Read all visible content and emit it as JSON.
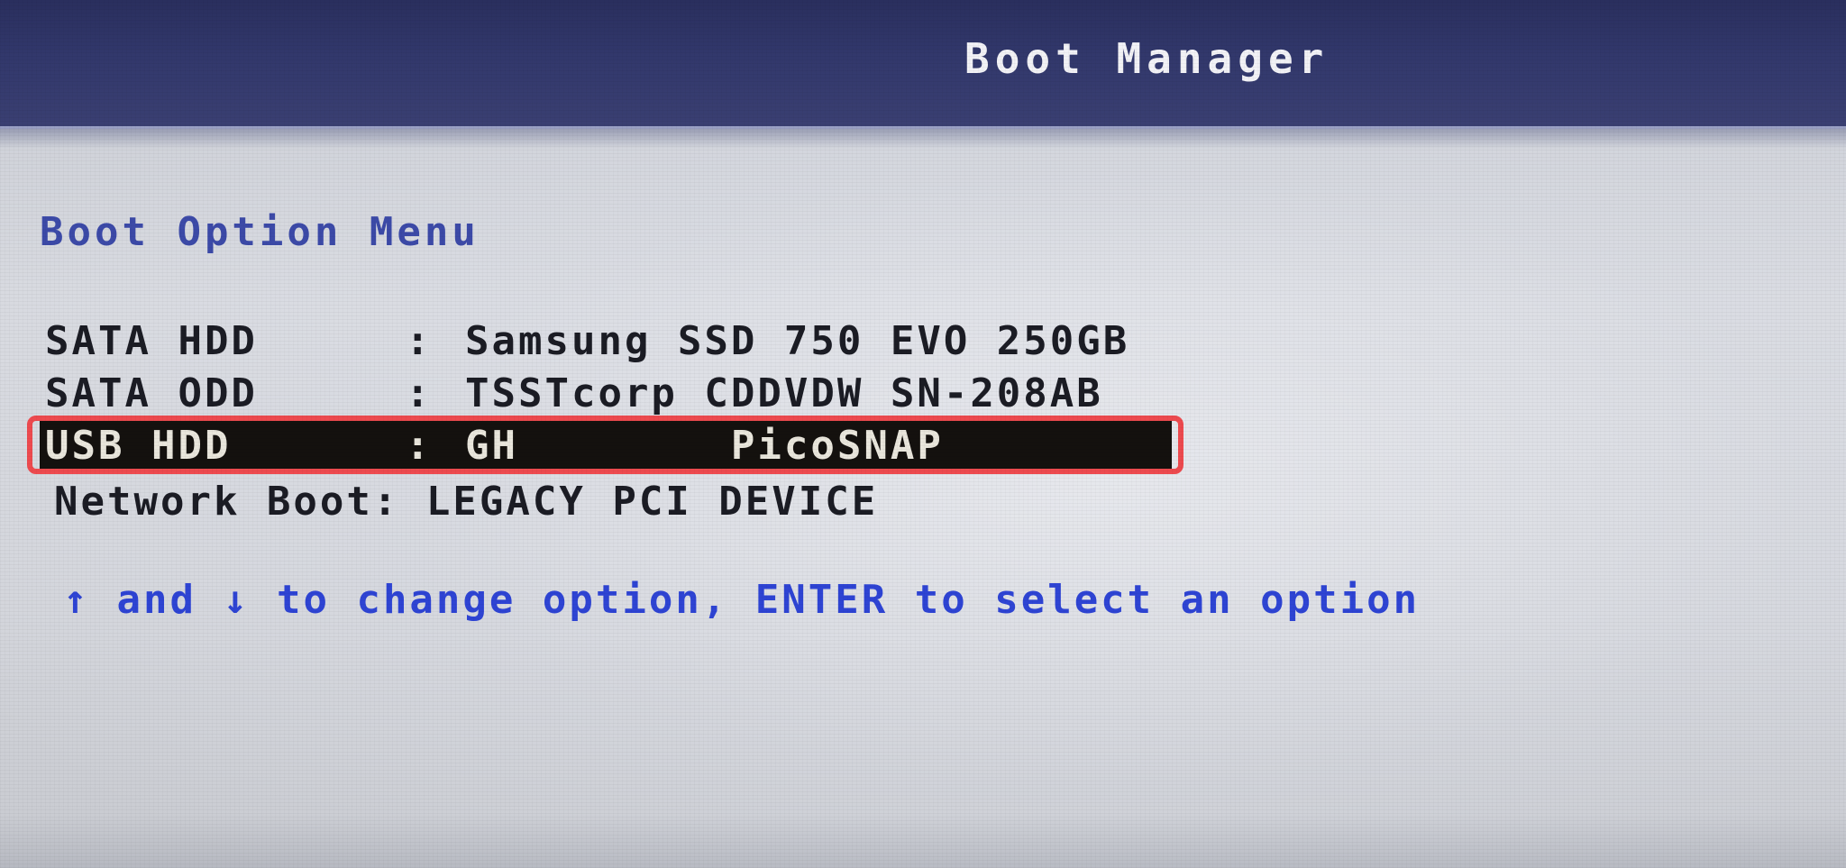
{
  "header": {
    "title": "Boot Manager"
  },
  "menu": {
    "heading": "Boot Option Menu",
    "separator": ":",
    "items": [
      {
        "type": "SATA HDD",
        "device": "Samsung SSD 750 EVO 250GB",
        "selected": false
      },
      {
        "type": "SATA ODD",
        "device": "TSSTcorp CDDVDW SN-208AB",
        "selected": false
      },
      {
        "type": "USB HDD",
        "device": "GH        PicoSNAP",
        "selected": true
      },
      {
        "type": "Network Boot",
        "device": "LEGACY PCI DEVICE",
        "selected": false
      }
    ]
  },
  "hint": {
    "up_arrow": "↑",
    "text_and": "and",
    "down_arrow": "↓",
    "text_rest": "to change option, ENTER to select an option"
  },
  "colors": {
    "header_bg": "#32386c",
    "heading_blue": "#3c4aa8",
    "hint_blue": "#2e44d4",
    "selected_bg": "#14110e",
    "annotation_red": "#ee4a4f"
  }
}
